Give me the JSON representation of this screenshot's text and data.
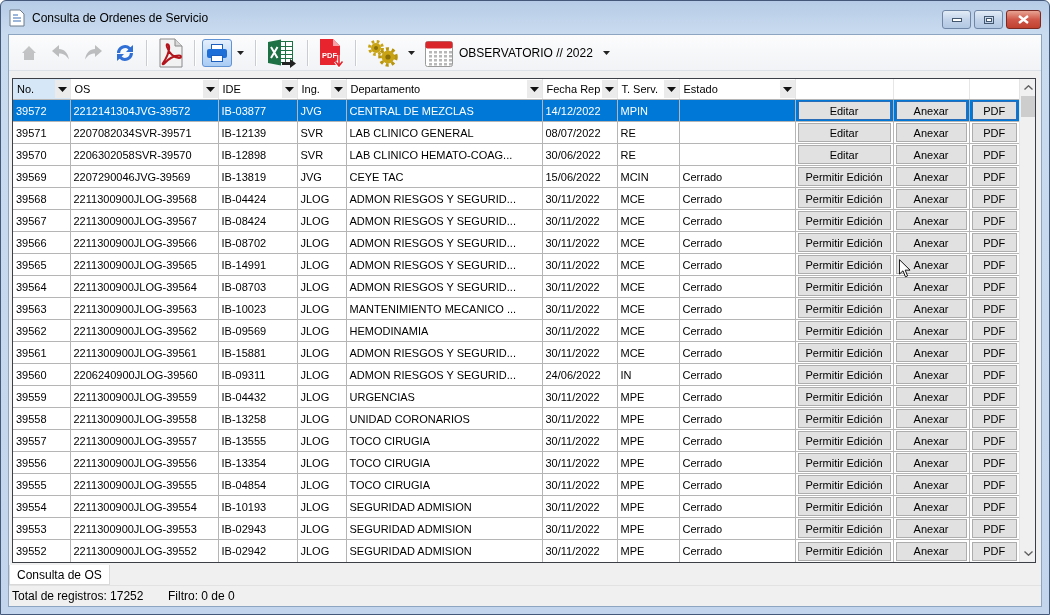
{
  "window": {
    "title": "Consulta de Ordenes de Servicio"
  },
  "toolbar": {
    "groups": [
      [
        {
          "kind": "home",
          "disabled": true,
          "pressed": false,
          "dropdown": false
        },
        {
          "kind": "back",
          "disabled": true,
          "pressed": false,
          "dropdown": false
        },
        {
          "kind": "forward",
          "disabled": true,
          "pressed": false,
          "dropdown": false
        },
        {
          "kind": "refresh",
          "disabled": false,
          "pressed": false,
          "dropdown": false
        }
      ],
      [
        {
          "kind": "acrobat",
          "disabled": false,
          "pressed": false,
          "dropdown": false
        }
      ],
      [
        {
          "kind": "print",
          "disabled": false,
          "pressed": true,
          "dropdown": true
        }
      ],
      [
        {
          "kind": "excel",
          "disabled": false,
          "pressed": false,
          "dropdown": false
        }
      ],
      [
        {
          "kind": "pdf",
          "caption": "PDF",
          "disabled": false,
          "pressed": false,
          "dropdown": false
        }
      ],
      [
        {
          "kind": "gears",
          "disabled": false,
          "pressed": false,
          "dropdown": true
        },
        {
          "kind": "calendar",
          "label": "OBSERVATORIO // 2022",
          "disabled": false,
          "pressed": false,
          "dropdown": true
        }
      ]
    ]
  },
  "grid": {
    "columns": [
      {
        "label": "No.",
        "highlighted": true
      },
      {
        "label": "OS",
        "highlighted": false
      },
      {
        "label": "IDE",
        "highlighted": false
      },
      {
        "label": "Ing.",
        "highlighted": false
      },
      {
        "label": "Departamento",
        "highlighted": false
      },
      {
        "label": "Fecha Rep",
        "highlighted": false
      },
      {
        "label": "T. Serv.",
        "highlighted": false
      },
      {
        "label": "Estado",
        "highlighted": false
      }
    ],
    "rows": [
      {
        "selected": true,
        "no": "39572",
        "os": "2212141304JVG-39572",
        "ide": "IB-03877",
        "ing": "JVG",
        "departamento": "CENTRAL DE MEZCLAS",
        "fecha_rep": "14/12/2022",
        "t_serv": "MPIN",
        "buttons": [
          "Editar",
          "Anexar",
          "PDF"
        ]
      },
      {
        "selected": false,
        "no": "39571",
        "os": "2207082034SVR-39571",
        "ide": "IB-12139",
        "ing": "SVR",
        "departamento": "LAB CLINICO GENERAL",
        "fecha_rep": "08/07/2022",
        "t_serv": "RE",
        "buttons": [
          "Editar",
          "Anexar",
          "PDF"
        ]
      },
      {
        "selected": false,
        "no": "39570",
        "os": "2206302058SVR-39570",
        "ide": "IB-12898",
        "ing": "SVR",
        "departamento": "LAB CLINICO HEMATO-COAG...",
        "fecha_rep": "30/06/2022",
        "t_serv": "RE",
        "buttons": [
          "Editar",
          "Anexar",
          "PDF"
        ]
      },
      {
        "selected": false,
        "no": "39569",
        "os": "2207290046JVG-39569",
        "ide": "IB-13819",
        "ing": "JVG",
        "departamento": "CEYE TAC",
        "fecha_rep": "15/06/2022",
        "t_serv": "MCIN",
        "estado": "Cerrado",
        "buttons": [
          "Permitir Edición",
          "Anexar",
          "PDF"
        ]
      },
      {
        "selected": false,
        "no": "39568",
        "os": "2211300900JLOG-39568",
        "ide": "IB-04424",
        "ing": "JLOG",
        "departamento": "ADMON RIESGOS Y SEGURID...",
        "fecha_rep": "30/11/2022",
        "t_serv": "MCE",
        "estado": "Cerrado",
        "buttons": [
          "Permitir Edición",
          "Anexar",
          "PDF"
        ]
      },
      {
        "selected": false,
        "no": "39567",
        "os": "2211300900JLOG-39567",
        "ide": "IB-08424",
        "ing": "JLOG",
        "departamento": "ADMON RIESGOS Y SEGURID...",
        "fecha_rep": "30/11/2022",
        "t_serv": "MCE",
        "estado": "Cerrado",
        "buttons": [
          "Permitir Edición",
          "Anexar",
          "PDF"
        ]
      },
      {
        "selected": false,
        "no": "39566",
        "os": "2211300900JLOG-39566",
        "ide": "IB-08702",
        "ing": "JLOG",
        "departamento": "ADMON RIESGOS Y SEGURID...",
        "fecha_rep": "30/11/2022",
        "t_serv": "MCE",
        "estado": "Cerrado",
        "buttons": [
          "Permitir Edición",
          "Anexar",
          "PDF"
        ]
      },
      {
        "selected": false,
        "no": "39565",
        "os": "2211300900JLOG-39565",
        "ide": "IB-14991",
        "ing": "JLOG",
        "departamento": "ADMON RIESGOS Y SEGURID...",
        "fecha_rep": "30/11/2022",
        "t_serv": "MCE",
        "estado": "Cerrado",
        "buttons": [
          "Permitir Edición",
          "Anexar",
          "PDF"
        ]
      },
      {
        "selected": false,
        "no": "39564",
        "os": "2211300900JLOG-39564",
        "ide": "IB-08703",
        "ing": "JLOG",
        "departamento": "ADMON RIESGOS Y SEGURID...",
        "fecha_rep": "30/11/2022",
        "t_serv": "MCE",
        "estado": "Cerrado",
        "buttons": [
          "Permitir Edición",
          "Anexar",
          "PDF"
        ]
      },
      {
        "selected": false,
        "no": "39563",
        "os": "2211300900JLOG-39563",
        "ide": "IB-10023",
        "ing": "JLOG",
        "departamento": "MANTENIMIENTO MECANICO ...",
        "fecha_rep": "30/11/2022",
        "t_serv": "MCE",
        "estado": "Cerrado",
        "buttons": [
          "Permitir Edición",
          "Anexar",
          "PDF"
        ]
      },
      {
        "selected": false,
        "no": "39562",
        "os": "2211300900JLOG-39562",
        "ide": "IB-09569",
        "ing": "JLOG",
        "departamento": "HEMODINAMIA",
        "fecha_rep": "30/11/2022",
        "t_serv": "MCE",
        "estado": "Cerrado",
        "buttons": [
          "Permitir Edición",
          "Anexar",
          "PDF"
        ]
      },
      {
        "selected": false,
        "no": "39561",
        "os": "2211300900JLOG-39561",
        "ide": "IB-15881",
        "ing": "JLOG",
        "departamento": "ADMON RIESGOS Y SEGURID...",
        "fecha_rep": "30/11/2022",
        "t_serv": "MCE",
        "estado": "Cerrado",
        "buttons": [
          "Permitir Edición",
          "Anexar",
          "PDF"
        ]
      },
      {
        "selected": false,
        "no": "39560",
        "os": "2206240900JLOG-39560",
        "ide": "IB-09311",
        "ing": "JLOG",
        "departamento": "ADMON RIESGOS Y SEGURID...",
        "fecha_rep": "24/06/2022",
        "t_serv": "IN",
        "estado": "Cerrado",
        "buttons": [
          "Permitir Edición",
          "Anexar",
          "PDF"
        ]
      },
      {
        "selected": false,
        "no": "39559",
        "os": "2211300900JLOG-39559",
        "ide": "IB-04432",
        "ing": "JLOG",
        "departamento": "URGENCIAS",
        "fecha_rep": "30/11/2022",
        "t_serv": "MPE",
        "estado": "Cerrado",
        "buttons": [
          "Permitir Edición",
          "Anexar",
          "PDF"
        ]
      },
      {
        "selected": false,
        "no": "39558",
        "os": "2211300900JLOG-39558",
        "ide": "IB-13258",
        "ing": "JLOG",
        "departamento": "UNIDAD CORONARIOS",
        "fecha_rep": "30/11/2022",
        "t_serv": "MPE",
        "estado": "Cerrado",
        "buttons": [
          "Permitir Edición",
          "Anexar",
          "PDF"
        ]
      },
      {
        "selected": false,
        "no": "39557",
        "os": "2211300900JLOG-39557",
        "ide": "IB-13555",
        "ing": "JLOG",
        "departamento": "TOCO CIRUGIA",
        "fecha_rep": "30/11/2022",
        "t_serv": "MPE",
        "estado": "Cerrado",
        "buttons": [
          "Permitir Edición",
          "Anexar",
          "PDF"
        ]
      },
      {
        "selected": false,
        "no": "39556",
        "os": "2211300900JLOG-39556",
        "ide": "IB-13354",
        "ing": "JLOG",
        "departamento": "TOCO CIRUGIA",
        "fecha_rep": "30/11/2022",
        "t_serv": "MPE",
        "estado": "Cerrado",
        "buttons": [
          "Permitir Edición",
          "Anexar",
          "PDF"
        ]
      },
      {
        "selected": false,
        "no": "39555",
        "os": "2211300900JLOG-39555",
        "ide": "IB-04854",
        "ing": "JLOG",
        "departamento": "TOCO CIRUGIA",
        "fecha_rep": "30/11/2022",
        "t_serv": "MPE",
        "estado": "Cerrado",
        "buttons": [
          "Permitir Edición",
          "Anexar",
          "PDF"
        ]
      },
      {
        "selected": false,
        "no": "39554",
        "os": "2211300900JLOG-39554",
        "ide": "IB-10193",
        "ing": "JLOG",
        "departamento": "SEGURIDAD ADMISION",
        "fecha_rep": "30/11/2022",
        "t_serv": "MPE",
        "estado": "Cerrado",
        "buttons": [
          "Permitir Edición",
          "Anexar",
          "PDF"
        ]
      },
      {
        "selected": false,
        "no": "39553",
        "os": "2211300900JLOG-39553",
        "ide": "IB-02943",
        "ing": "JLOG",
        "departamento": "SEGURIDAD ADMISION",
        "fecha_rep": "30/11/2022",
        "t_serv": "MPE",
        "estado": "Cerrado",
        "buttons": [
          "Permitir Edición",
          "Anexar",
          "PDF"
        ]
      },
      {
        "selected": false,
        "no": "39552",
        "os": "2211300900JLOG-39552",
        "ide": "IB-02942",
        "ing": "JLOG",
        "departamento": "SEGURIDAD ADMISION",
        "fecha_rep": "30/11/2022",
        "t_serv": "MPE",
        "estado": "Cerrado",
        "buttons": [
          "Permitir Edición",
          "Anexar",
          "PDF"
        ]
      }
    ]
  },
  "tabs": [
    {
      "label": "Consulta de OS",
      "selected": true
    }
  ],
  "status_bar": {
    "total": "Total de registros: 17252",
    "filter": "Filtro: 0 de 0"
  }
}
